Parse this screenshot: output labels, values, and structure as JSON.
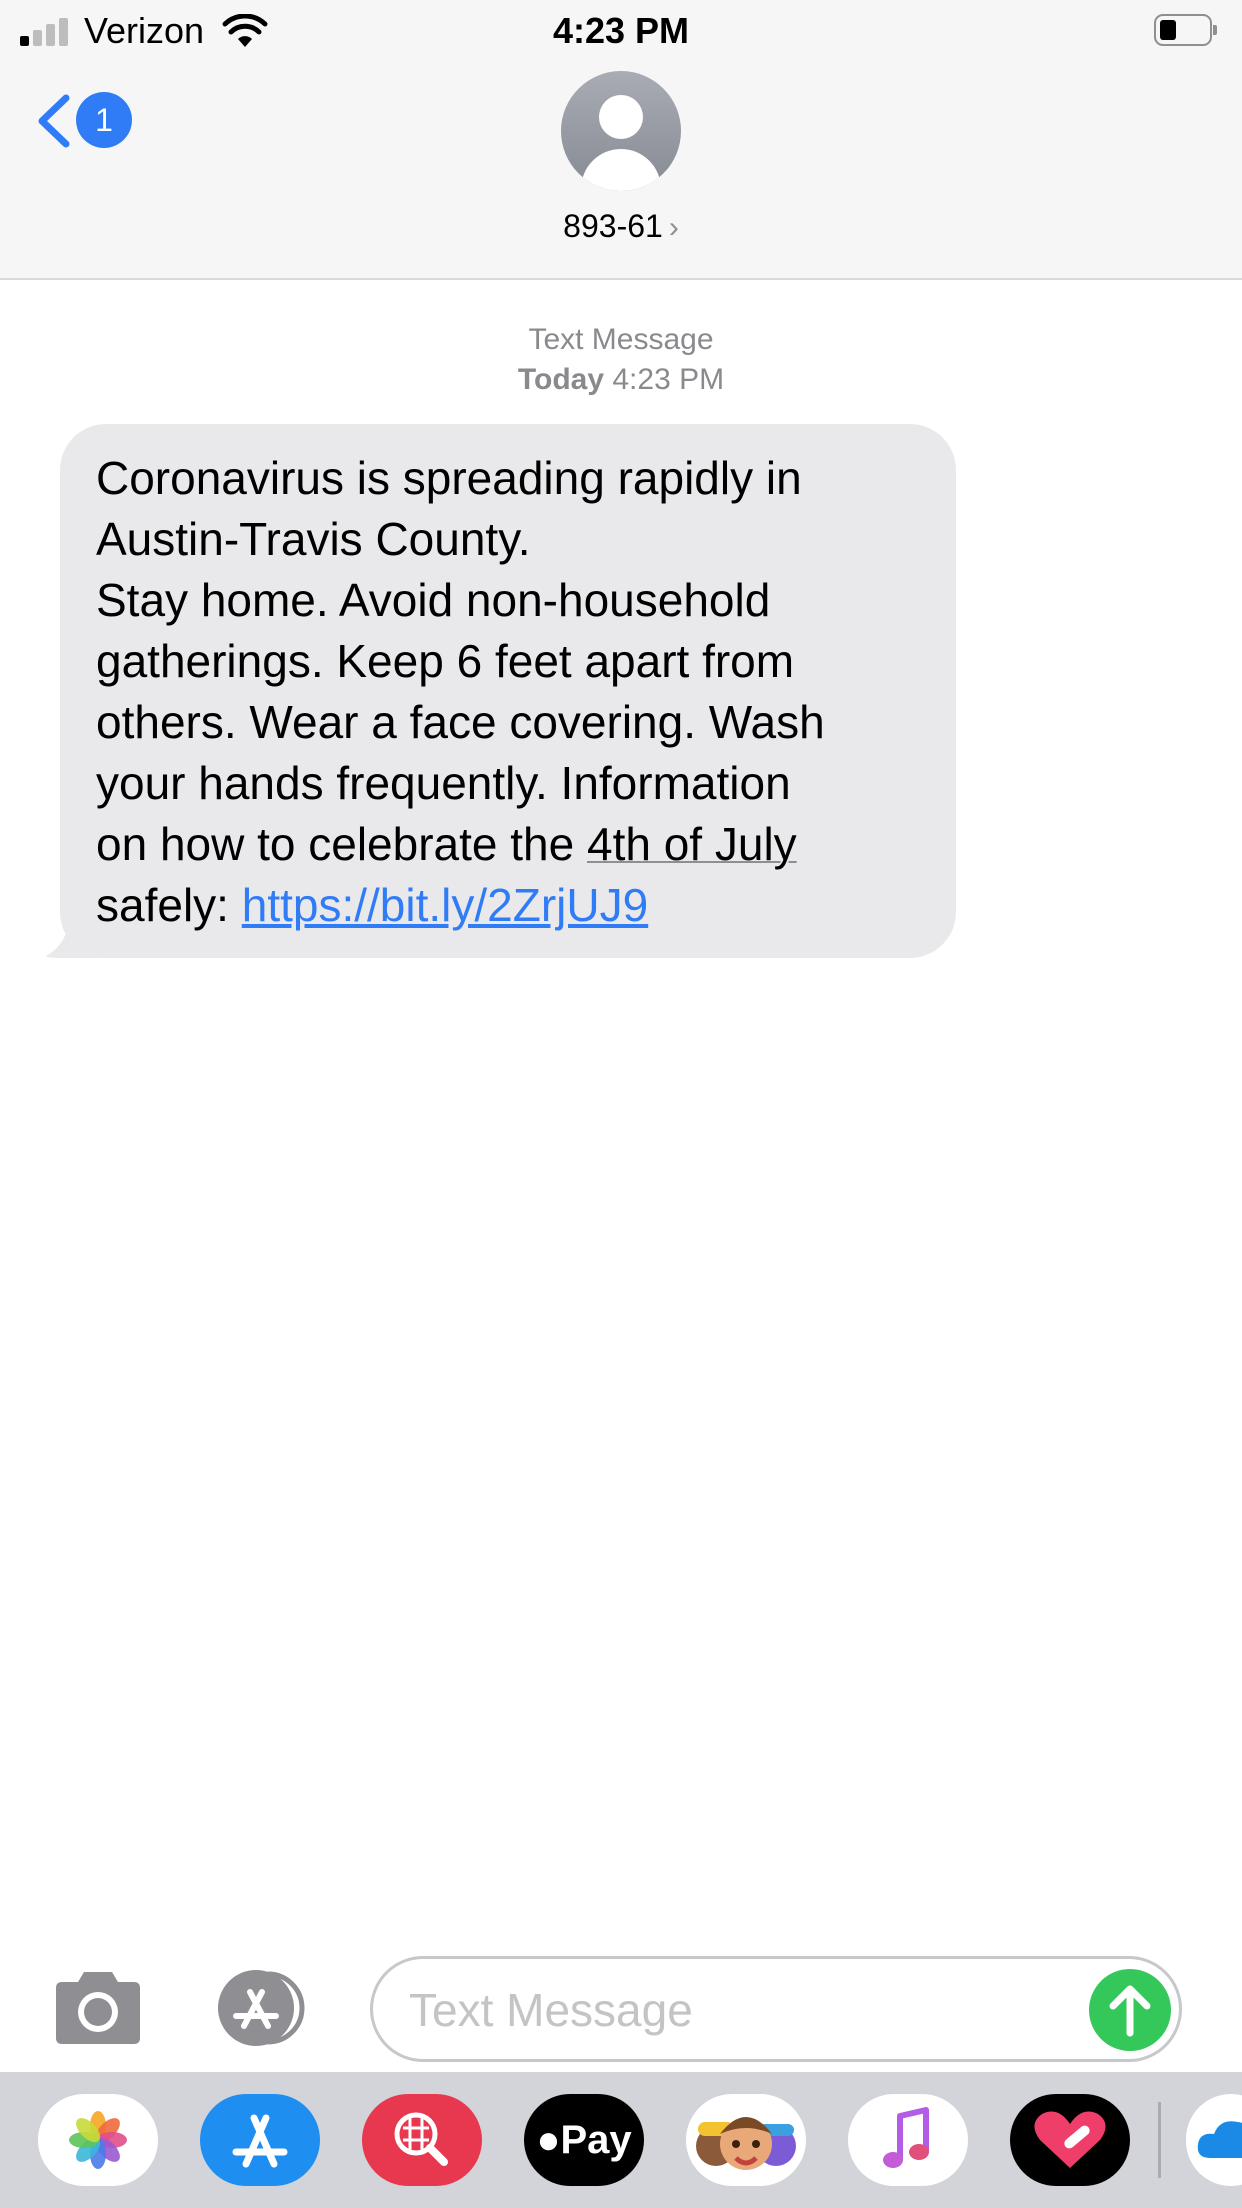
{
  "status_bar": {
    "carrier": "Verizon",
    "time": "4:23 PM"
  },
  "nav": {
    "back_badge": "1",
    "contact_name": "893-61",
    "contact_chevron": "›"
  },
  "conversation": {
    "service": "Text Message",
    "day": "Today",
    "time": "4:23 PM",
    "message": {
      "line1": "Coronavirus is spreading rapidly in",
      "line2": "Austin-Travis County.",
      "line3": "Stay home. Avoid non-household",
      "line4": "gatherings. Keep 6 feet apart from",
      "line5": "others. Wear a face covering. Wash",
      "line6": "your hands frequently. Information",
      "line7_prefix": "on how to celebrate the ",
      "line7_date": "4th of July",
      "line8_prefix": "safely: ",
      "link": "https://bit.ly/2ZrjUJ9"
    }
  },
  "composer": {
    "placeholder": "Text Message"
  },
  "app_drawer": {
    "apps": [
      "photos-icon",
      "app-store-icon",
      "images-search-icon",
      "apple-pay-icon",
      "memoji-icon",
      "music-icon",
      "fitness-icon",
      "cloud-icon"
    ],
    "apple_pay_label": "Pay"
  },
  "colors": {
    "accent": "#2f7cf6",
    "bubble": "#e9e9eb",
    "send": "#34c759"
  }
}
